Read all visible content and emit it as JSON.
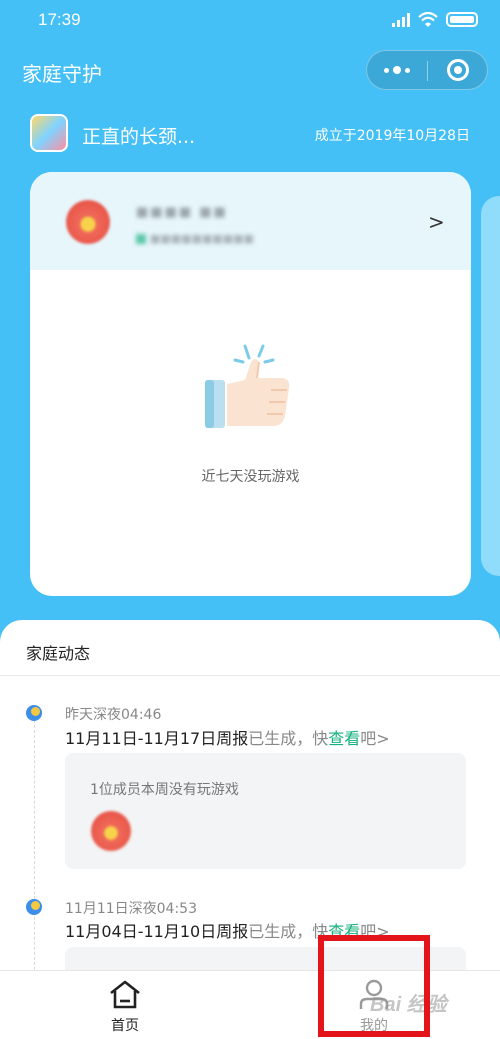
{
  "status_bar": {
    "time": "17:39"
  },
  "nav": {
    "title": "家庭守护"
  },
  "family": {
    "name": "正直的长颈...",
    "founded": "成立于2019年10月28日"
  },
  "member_card": {
    "name": "■■■■ ■■",
    "subtitle": "■■■■■■■■■■",
    "chevron": ">",
    "empty_text": "近七天没玩游戏"
  },
  "feed": {
    "title": "家庭动态",
    "items": [
      {
        "time": "昨天深夜04:46",
        "report": "11月11日-11月17日周报",
        "suffix": "已生成，快",
        "link": "查看",
        "tail": "吧",
        "arrow": ">",
        "box_text": "1位成员本周没有玩游戏"
      },
      {
        "time": "11月11日深夜04:53",
        "report": "11月04日-11月10日周报",
        "suffix": "已生成，快",
        "link": "查看",
        "tail": "吧",
        "arrow": ">"
      }
    ]
  },
  "tabbar": {
    "home": "首页",
    "mine": "我的"
  },
  "watermark": "Bai 经验",
  "colors": {
    "header_bg": "#45c0f6",
    "link": "#16b07c",
    "highlight": "#e3141a"
  },
  "icons": [
    "home-icon",
    "user-icon",
    "moon-icon",
    "thumbs-up-icon",
    "more-icon",
    "close-icon"
  ]
}
